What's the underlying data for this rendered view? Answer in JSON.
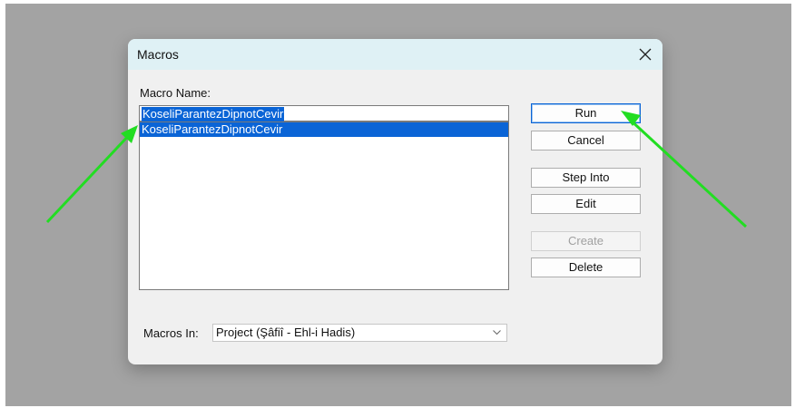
{
  "dialog": {
    "title": "Macros",
    "close_icon": "close-icon",
    "macro_name_label": "Macro Name:",
    "macro_name_value": "KoseliParantezDipnotCevir",
    "macro_list": [
      {
        "name": "KoseliParantezDipnotCevir",
        "selected": true
      }
    ],
    "buttons": {
      "run": "Run",
      "cancel": "Cancel",
      "step_into": "Step Into",
      "edit": "Edit",
      "create": "Create",
      "delete": "Delete"
    },
    "macros_in_label": "Macros In:",
    "macros_in_value": "Project (Şâfiî - Ehl-i Hadis)"
  },
  "annotations": {
    "arrow_color": "#22dd22",
    "arrow_icons": [
      "green-arrow-icon",
      "green-arrow-icon"
    ]
  },
  "colors": {
    "selection": "#0a64d6",
    "titlebar": "#dff1f5"
  }
}
